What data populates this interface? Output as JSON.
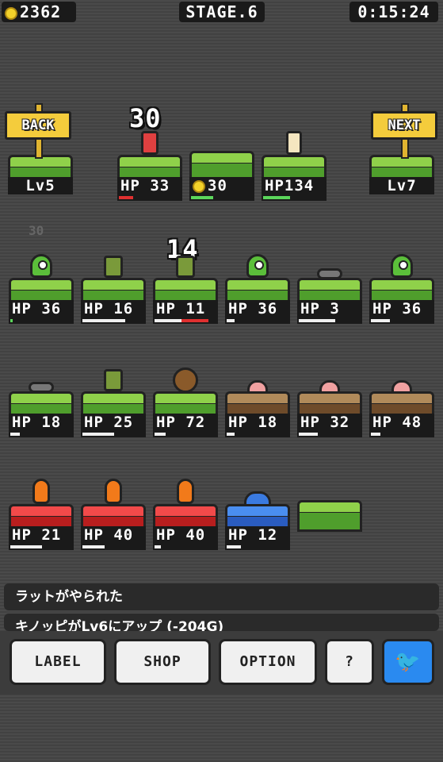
{
  "header": {
    "gold": "2362",
    "stage": "STAGE.6",
    "timer": "0:15:24"
  },
  "nav": {
    "back_label": "BACK",
    "back_level": "Lv5",
    "next_label": "NEXT",
    "next_level": "Lv7"
  },
  "party": {
    "floating_number": "30",
    "ghost_number": "30",
    "hero_hp": "HP 33",
    "coin_value": "30",
    "ally_hp": "HP134"
  },
  "enemy_damage_popup": "14",
  "grid": {
    "row1": [
      "HP 36",
      "HP 16",
      "HP 11",
      "HP 36",
      "HP  3",
      "HP 36"
    ],
    "row2": [
      "HP 18",
      "HP 25",
      "HP 72",
      "HP 18",
      "HP 32",
      "HP 48"
    ],
    "row3": [
      "HP 21",
      "HP 40",
      "HP 40",
      "HP 12"
    ]
  },
  "messages": [
    "ラットがやられた",
    "キノッピがLv6にアップ (-204G)"
  ],
  "buttons": {
    "label": "LABEL",
    "shop": "SHOP",
    "option": "OPTION",
    "help": "?",
    "twitter": "🐦"
  },
  "colors": {
    "hp_bar": "#5bd65b",
    "damage_bar": "#e03030",
    "twitter": "#2a8af0",
    "sign": "#f4cc3c"
  }
}
